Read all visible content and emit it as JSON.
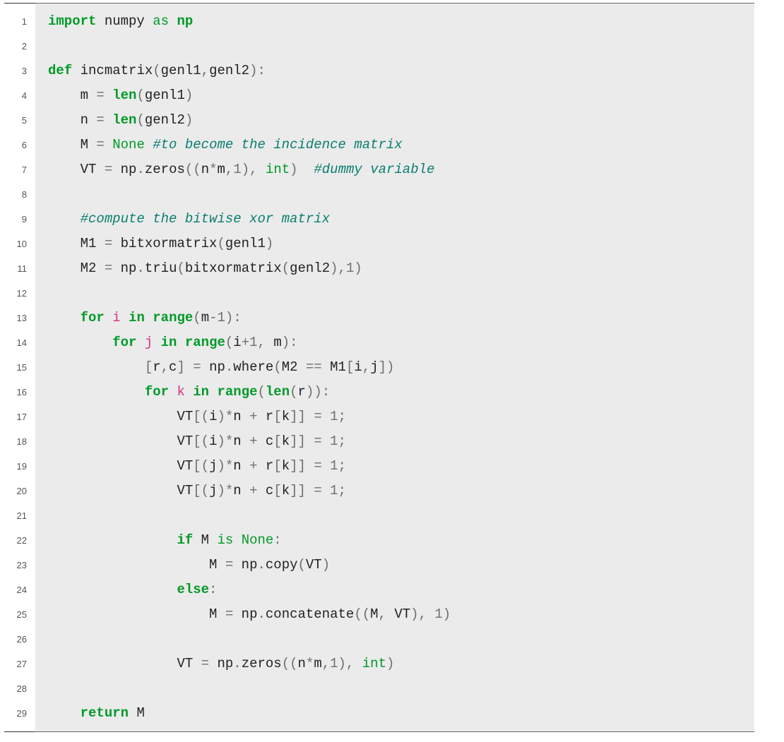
{
  "colors": {
    "background": "#ebebeb",
    "gutter_bg": "#ffffff",
    "rule": "#333333",
    "keyword": "#009A28",
    "builtin": "#009A28",
    "operator": "#6F6F6F",
    "number": "#6F6F6F",
    "loopvar": "#D63384",
    "comment": "#0A7E6F",
    "text": "#222222"
  },
  "line_numbers": [
    "1",
    "2",
    "3",
    "4",
    "5",
    "6",
    "7",
    "8",
    "9",
    "10",
    "11",
    "12",
    "13",
    "14",
    "15",
    "16",
    "17",
    "18",
    "19",
    "20",
    "21",
    "22",
    "23",
    "24",
    "25",
    "26",
    "27",
    "28",
    "29"
  ],
  "code": {
    "raw": [
      "import numpy as np",
      "",
      "def incmatrix(genl1,genl2):",
      "    m = len(genl1)",
      "    n = len(genl2)",
      "    M = None #to become the incidence matrix",
      "    VT = np.zeros((n*m,1), int)  #dummy variable",
      "",
      "    #compute the bitwise xor matrix",
      "    M1 = bitxormatrix(genl1)",
      "    M2 = np.triu(bitxormatrix(genl2),1)",
      "",
      "    for i in range(m-1):",
      "        for j in range(i+1, m):",
      "            [r,c] = np.where(M2 == M1[i,j])",
      "            for k in range(len(r)):",
      "                VT[(i)*n + r[k]] = 1;",
      "                VT[(i)*n + c[k]] = 1;",
      "                VT[(j)*n + r[k]] = 1;",
      "                VT[(j)*n + c[k]] = 1;",
      "",
      "                if M is None:",
      "                    M = np.copy(VT)",
      "                else:",
      "                    M = np.concatenate((M, VT), 1)",
      "",
      "                VT = np.zeros((n*m,1), int)",
      "",
      "    return M"
    ],
    "lines": [
      [
        [
          "kw",
          "import"
        ],
        [
          "sp",
          " "
        ],
        [
          "name",
          "numpy"
        ],
        [
          "sp",
          " "
        ],
        [
          "builtin",
          "as"
        ],
        [
          "sp",
          " "
        ],
        [
          "kw",
          "np"
        ]
      ],
      [],
      [
        [
          "kw",
          "def"
        ],
        [
          "sp",
          " "
        ],
        [
          "name",
          "incmatrix"
        ],
        [
          "op",
          "("
        ],
        [
          "name",
          "genl1"
        ],
        [
          "op",
          ","
        ],
        [
          "name",
          "genl2"
        ],
        [
          "op",
          ")"
        ],
        [
          "op",
          ":"
        ]
      ],
      [
        [
          "sp",
          "    "
        ],
        [
          "name",
          "m"
        ],
        [
          "sp",
          " "
        ],
        [
          "op",
          "="
        ],
        [
          "sp",
          " "
        ],
        [
          "kw",
          "len"
        ],
        [
          "op",
          "("
        ],
        [
          "name",
          "genl1"
        ],
        [
          "op",
          ")"
        ]
      ],
      [
        [
          "sp",
          "    "
        ],
        [
          "name",
          "n"
        ],
        [
          "sp",
          " "
        ],
        [
          "op",
          "="
        ],
        [
          "sp",
          " "
        ],
        [
          "kw",
          "len"
        ],
        [
          "op",
          "("
        ],
        [
          "name",
          "genl2"
        ],
        [
          "op",
          ")"
        ]
      ],
      [
        [
          "sp",
          "    "
        ],
        [
          "name",
          "M"
        ],
        [
          "sp",
          " "
        ],
        [
          "op",
          "="
        ],
        [
          "sp",
          " "
        ],
        [
          "builtin",
          "None"
        ],
        [
          "sp",
          " "
        ],
        [
          "cmt",
          "#to become the incidence matrix"
        ]
      ],
      [
        [
          "sp",
          "    "
        ],
        [
          "name",
          "VT"
        ],
        [
          "sp",
          " "
        ],
        [
          "op",
          "="
        ],
        [
          "sp",
          " "
        ],
        [
          "name",
          "np"
        ],
        [
          "op",
          "."
        ],
        [
          "name",
          "zeros"
        ],
        [
          "op",
          "(("
        ],
        [
          "name",
          "n"
        ],
        [
          "op",
          "*"
        ],
        [
          "name",
          "m"
        ],
        [
          "op",
          ","
        ],
        [
          "num",
          "1"
        ],
        [
          "op",
          ")"
        ],
        [
          "op",
          ","
        ],
        [
          "sp",
          " "
        ],
        [
          "builtin",
          "int"
        ],
        [
          "op",
          ")"
        ],
        [
          "sp",
          "  "
        ],
        [
          "cmt",
          "#dummy variable"
        ]
      ],
      [],
      [
        [
          "sp",
          "    "
        ],
        [
          "cmt",
          "#compute the bitwise xor matrix"
        ]
      ],
      [
        [
          "sp",
          "    "
        ],
        [
          "name",
          "M1"
        ],
        [
          "sp",
          " "
        ],
        [
          "op",
          "="
        ],
        [
          "sp",
          " "
        ],
        [
          "name",
          "bitxormatrix"
        ],
        [
          "op",
          "("
        ],
        [
          "name",
          "genl1"
        ],
        [
          "op",
          ")"
        ]
      ],
      [
        [
          "sp",
          "    "
        ],
        [
          "name",
          "M2"
        ],
        [
          "sp",
          " "
        ],
        [
          "op",
          "="
        ],
        [
          "sp",
          " "
        ],
        [
          "name",
          "np"
        ],
        [
          "op",
          "."
        ],
        [
          "name",
          "triu"
        ],
        [
          "op",
          "("
        ],
        [
          "name",
          "bitxormatrix"
        ],
        [
          "op",
          "("
        ],
        [
          "name",
          "genl2"
        ],
        [
          "op",
          ")"
        ],
        [
          "op",
          ","
        ],
        [
          "num",
          "1"
        ],
        [
          "op",
          ")"
        ]
      ],
      [],
      [
        [
          "sp",
          "    "
        ],
        [
          "kw",
          "for"
        ],
        [
          "sp",
          " "
        ],
        [
          "pink",
          "i"
        ],
        [
          "sp",
          " "
        ],
        [
          "kw",
          "in"
        ],
        [
          "sp",
          " "
        ],
        [
          "kw",
          "range"
        ],
        [
          "op",
          "("
        ],
        [
          "name",
          "m"
        ],
        [
          "op",
          "-"
        ],
        [
          "num",
          "1"
        ],
        [
          "op",
          ")"
        ],
        [
          "op",
          ":"
        ]
      ],
      [
        [
          "sp",
          "        "
        ],
        [
          "kw",
          "for"
        ],
        [
          "sp",
          " "
        ],
        [
          "pink",
          "j"
        ],
        [
          "sp",
          " "
        ],
        [
          "kw",
          "in"
        ],
        [
          "sp",
          " "
        ],
        [
          "kw",
          "range"
        ],
        [
          "op",
          "("
        ],
        [
          "name",
          "i"
        ],
        [
          "op",
          "+"
        ],
        [
          "num",
          "1"
        ],
        [
          "op",
          ","
        ],
        [
          "sp",
          " "
        ],
        [
          "name",
          "m"
        ],
        [
          "op",
          ")"
        ],
        [
          "op",
          ":"
        ]
      ],
      [
        [
          "sp",
          "            "
        ],
        [
          "op",
          "["
        ],
        [
          "name",
          "r"
        ],
        [
          "op",
          ","
        ],
        [
          "name",
          "c"
        ],
        [
          "op",
          "]"
        ],
        [
          "sp",
          " "
        ],
        [
          "op",
          "="
        ],
        [
          "sp",
          " "
        ],
        [
          "name",
          "np"
        ],
        [
          "op",
          "."
        ],
        [
          "name",
          "where"
        ],
        [
          "op",
          "("
        ],
        [
          "name",
          "M2"
        ],
        [
          "sp",
          " "
        ],
        [
          "op",
          "=="
        ],
        [
          "sp",
          " "
        ],
        [
          "name",
          "M1"
        ],
        [
          "op",
          "["
        ],
        [
          "name",
          "i"
        ],
        [
          "op",
          ","
        ],
        [
          "name",
          "j"
        ],
        [
          "op",
          "]"
        ],
        [
          "op",
          ")"
        ]
      ],
      [
        [
          "sp",
          "            "
        ],
        [
          "kw",
          "for"
        ],
        [
          "sp",
          " "
        ],
        [
          "pink",
          "k"
        ],
        [
          "sp",
          " "
        ],
        [
          "kw",
          "in"
        ],
        [
          "sp",
          " "
        ],
        [
          "kw",
          "range"
        ],
        [
          "op",
          "("
        ],
        [
          "kw",
          "len"
        ],
        [
          "op",
          "("
        ],
        [
          "name",
          "r"
        ],
        [
          "op",
          ")"
        ],
        [
          "op",
          ")"
        ],
        [
          "op",
          ":"
        ]
      ],
      [
        [
          "sp",
          "                "
        ],
        [
          "name",
          "VT"
        ],
        [
          "op",
          "[("
        ],
        [
          "name",
          "i"
        ],
        [
          "op",
          ")"
        ],
        [
          "op",
          "*"
        ],
        [
          "name",
          "n"
        ],
        [
          "sp",
          " "
        ],
        [
          "op",
          "+"
        ],
        [
          "sp",
          " "
        ],
        [
          "name",
          "r"
        ],
        [
          "op",
          "["
        ],
        [
          "name",
          "k"
        ],
        [
          "op",
          "]]"
        ],
        [
          "sp",
          " "
        ],
        [
          "op",
          "="
        ],
        [
          "sp",
          " "
        ],
        [
          "num",
          "1"
        ],
        [
          "op",
          ";"
        ]
      ],
      [
        [
          "sp",
          "                "
        ],
        [
          "name",
          "VT"
        ],
        [
          "op",
          "[("
        ],
        [
          "name",
          "i"
        ],
        [
          "op",
          ")"
        ],
        [
          "op",
          "*"
        ],
        [
          "name",
          "n"
        ],
        [
          "sp",
          " "
        ],
        [
          "op",
          "+"
        ],
        [
          "sp",
          " "
        ],
        [
          "name",
          "c"
        ],
        [
          "op",
          "["
        ],
        [
          "name",
          "k"
        ],
        [
          "op",
          "]]"
        ],
        [
          "sp",
          " "
        ],
        [
          "op",
          "="
        ],
        [
          "sp",
          " "
        ],
        [
          "num",
          "1"
        ],
        [
          "op",
          ";"
        ]
      ],
      [
        [
          "sp",
          "                "
        ],
        [
          "name",
          "VT"
        ],
        [
          "op",
          "[("
        ],
        [
          "name",
          "j"
        ],
        [
          "op",
          ")"
        ],
        [
          "op",
          "*"
        ],
        [
          "name",
          "n"
        ],
        [
          "sp",
          " "
        ],
        [
          "op",
          "+"
        ],
        [
          "sp",
          " "
        ],
        [
          "name",
          "r"
        ],
        [
          "op",
          "["
        ],
        [
          "name",
          "k"
        ],
        [
          "op",
          "]]"
        ],
        [
          "sp",
          " "
        ],
        [
          "op",
          "="
        ],
        [
          "sp",
          " "
        ],
        [
          "num",
          "1"
        ],
        [
          "op",
          ";"
        ]
      ],
      [
        [
          "sp",
          "                "
        ],
        [
          "name",
          "VT"
        ],
        [
          "op",
          "[("
        ],
        [
          "name",
          "j"
        ],
        [
          "op",
          ")"
        ],
        [
          "op",
          "*"
        ],
        [
          "name",
          "n"
        ],
        [
          "sp",
          " "
        ],
        [
          "op",
          "+"
        ],
        [
          "sp",
          " "
        ],
        [
          "name",
          "c"
        ],
        [
          "op",
          "["
        ],
        [
          "name",
          "k"
        ],
        [
          "op",
          "]]"
        ],
        [
          "sp",
          " "
        ],
        [
          "op",
          "="
        ],
        [
          "sp",
          " "
        ],
        [
          "num",
          "1"
        ],
        [
          "op",
          ";"
        ]
      ],
      [],
      [
        [
          "sp",
          "                "
        ],
        [
          "kw",
          "if"
        ],
        [
          "sp",
          " "
        ],
        [
          "name",
          "M"
        ],
        [
          "sp",
          " "
        ],
        [
          "builtin",
          "is"
        ],
        [
          "sp",
          " "
        ],
        [
          "builtin",
          "None"
        ],
        [
          "op",
          ":"
        ]
      ],
      [
        [
          "sp",
          "                    "
        ],
        [
          "name",
          "M"
        ],
        [
          "sp",
          " "
        ],
        [
          "op",
          "="
        ],
        [
          "sp",
          " "
        ],
        [
          "name",
          "np"
        ],
        [
          "op",
          "."
        ],
        [
          "name",
          "copy"
        ],
        [
          "op",
          "("
        ],
        [
          "name",
          "VT"
        ],
        [
          "op",
          ")"
        ]
      ],
      [
        [
          "sp",
          "                "
        ],
        [
          "kw",
          "else"
        ],
        [
          "op",
          ":"
        ]
      ],
      [
        [
          "sp",
          "                    "
        ],
        [
          "name",
          "M"
        ],
        [
          "sp",
          " "
        ],
        [
          "op",
          "="
        ],
        [
          "sp",
          " "
        ],
        [
          "name",
          "np"
        ],
        [
          "op",
          "."
        ],
        [
          "name",
          "concatenate"
        ],
        [
          "op",
          "(("
        ],
        [
          "name",
          "M"
        ],
        [
          "op",
          ","
        ],
        [
          "sp",
          " "
        ],
        [
          "name",
          "VT"
        ],
        [
          "op",
          ")"
        ],
        [
          "op",
          ","
        ],
        [
          "sp",
          " "
        ],
        [
          "num",
          "1"
        ],
        [
          "op",
          ")"
        ]
      ],
      [],
      [
        [
          "sp",
          "                "
        ],
        [
          "name",
          "VT"
        ],
        [
          "sp",
          " "
        ],
        [
          "op",
          "="
        ],
        [
          "sp",
          " "
        ],
        [
          "name",
          "np"
        ],
        [
          "op",
          "."
        ],
        [
          "name",
          "zeros"
        ],
        [
          "op",
          "(("
        ],
        [
          "name",
          "n"
        ],
        [
          "op",
          "*"
        ],
        [
          "name",
          "m"
        ],
        [
          "op",
          ","
        ],
        [
          "num",
          "1"
        ],
        [
          "op",
          ")"
        ],
        [
          "op",
          ","
        ],
        [
          "sp",
          " "
        ],
        [
          "builtin",
          "int"
        ],
        [
          "op",
          ")"
        ]
      ],
      [],
      [
        [
          "sp",
          "    "
        ],
        [
          "kw",
          "return"
        ],
        [
          "sp",
          " "
        ],
        [
          "name",
          "M"
        ]
      ]
    ]
  }
}
